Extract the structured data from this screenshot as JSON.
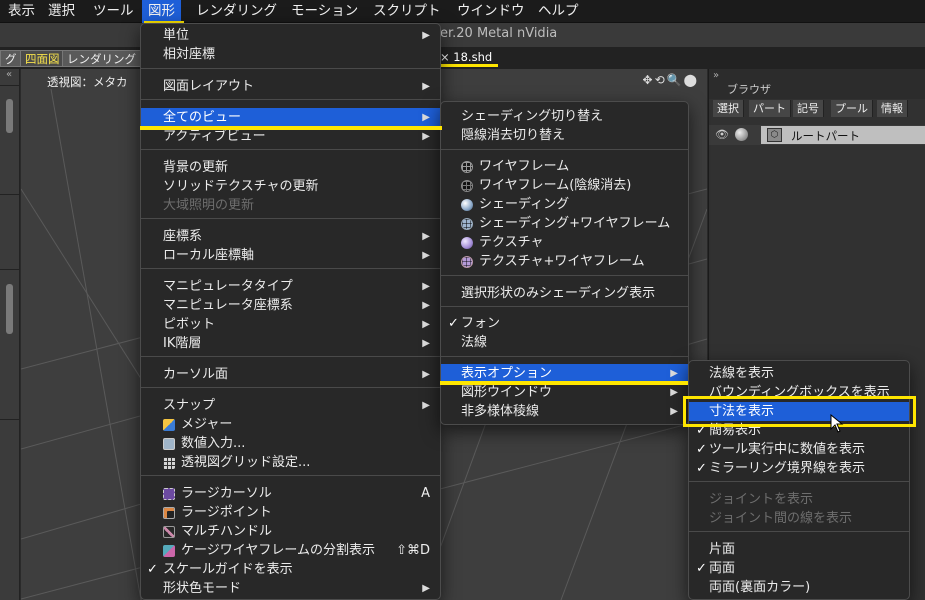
{
  "menubar": {
    "items": [
      "表示",
      "選択",
      "ツール",
      "図形",
      "レンダリング",
      "モーション",
      "スクリプト",
      "ウインドウ",
      "ヘルプ"
    ],
    "active_index": 3
  },
  "window": {
    "title": "er.20 Metal nVidia"
  },
  "tabs": {
    "items": [
      "グ",
      "四面図",
      "レンダリング"
    ],
    "doc_tab": "× 18.shd"
  },
  "viewport": {
    "title": "透視図：メタカ",
    "tools": "✥⟲🔍⬤"
  },
  "browser": {
    "collapse": "»",
    "title": "ブラウザ",
    "tabs": [
      "選択",
      "パート",
      "記号",
      "プール",
      "情報"
    ],
    "root_part": "ルートパート"
  },
  "left_panel": {
    "collapse": "«"
  },
  "menu_main": {
    "items": [
      {
        "label": "単位",
        "arrow": true
      },
      {
        "label": "相対座標"
      },
      {
        "label": "図面レイアウト",
        "arrow": true
      },
      {
        "label": "全てのビュー",
        "arrow": true,
        "highlight": true
      },
      {
        "label": "アクティブビュー",
        "arrow": true
      },
      {
        "label": "背景の更新"
      },
      {
        "label": "ソリッドテクスチャの更新"
      },
      {
        "label": "大域照明の更新",
        "disabled": true
      },
      {
        "label": "座標系",
        "arrow": true
      },
      {
        "label": "ローカル座標軸",
        "arrow": true
      },
      {
        "label": "マニピュレータタイプ",
        "arrow": true
      },
      {
        "label": "マニピュレータ座標系",
        "arrow": true
      },
      {
        "label": "ピボット",
        "arrow": true
      },
      {
        "label": "IK階層",
        "arrow": true
      },
      {
        "label": "カーソル面",
        "arrow": true
      },
      {
        "label": "スナップ",
        "arrow": true
      },
      {
        "label": "メジャー"
      },
      {
        "label": "数値入力..."
      },
      {
        "label": "透視図グリッド設定..."
      },
      {
        "label": "ラージカーソル",
        "shortcut": "A"
      },
      {
        "label": "ラージポイント"
      },
      {
        "label": "マルチハンドル"
      },
      {
        "label": "ケージワイヤフレームの分割表示",
        "shortcut": "⇧⌘D"
      },
      {
        "label": "スケールガイドを表示",
        "check": "✓"
      },
      {
        "label": "形状色モード",
        "arrow": true
      }
    ]
  },
  "menu_views": {
    "items": [
      {
        "label": "シェーディング切り替え"
      },
      {
        "label": "隠線消去切り替え"
      },
      {
        "label": "ワイヤフレーム"
      },
      {
        "label": "ワイヤフレーム(陰線消去)"
      },
      {
        "label": "シェーディング"
      },
      {
        "label": "シェーディング+ワイヤフレーム"
      },
      {
        "label": "テクスチャ"
      },
      {
        "label": "テクスチャ+ワイヤフレーム"
      },
      {
        "label": "選択形状のみシェーディング表示"
      },
      {
        "label": "フォン",
        "check": "✓"
      },
      {
        "label": "法線"
      },
      {
        "label": "表示オプション",
        "arrow": true,
        "highlight": true
      },
      {
        "label": "図形ウインドウ",
        "arrow": true
      },
      {
        "label": "非多様体稜線",
        "arrow": true
      }
    ]
  },
  "menu_options": {
    "items": [
      {
        "label": "法線を表示"
      },
      {
        "label": "バウンディングボックスを表示"
      },
      {
        "label": "寸法を表示",
        "highlight": true
      },
      {
        "label": "簡易表示",
        "check": "✓"
      },
      {
        "label": "ツール実行中に数値を表示",
        "check": "✓"
      },
      {
        "label": "ミラーリング境界線を表示",
        "check": "✓"
      },
      {
        "label": "ジョイントを表示",
        "disabled": true
      },
      {
        "label": "ジョイント間の線を表示",
        "disabled": true
      },
      {
        "label": "片面"
      },
      {
        "label": "両面",
        "check": "✓"
      },
      {
        "label": "両面(裏面カラー)"
      }
    ]
  },
  "annotation_color": "#ffe600",
  "highlight_color": "#1e5fd8"
}
